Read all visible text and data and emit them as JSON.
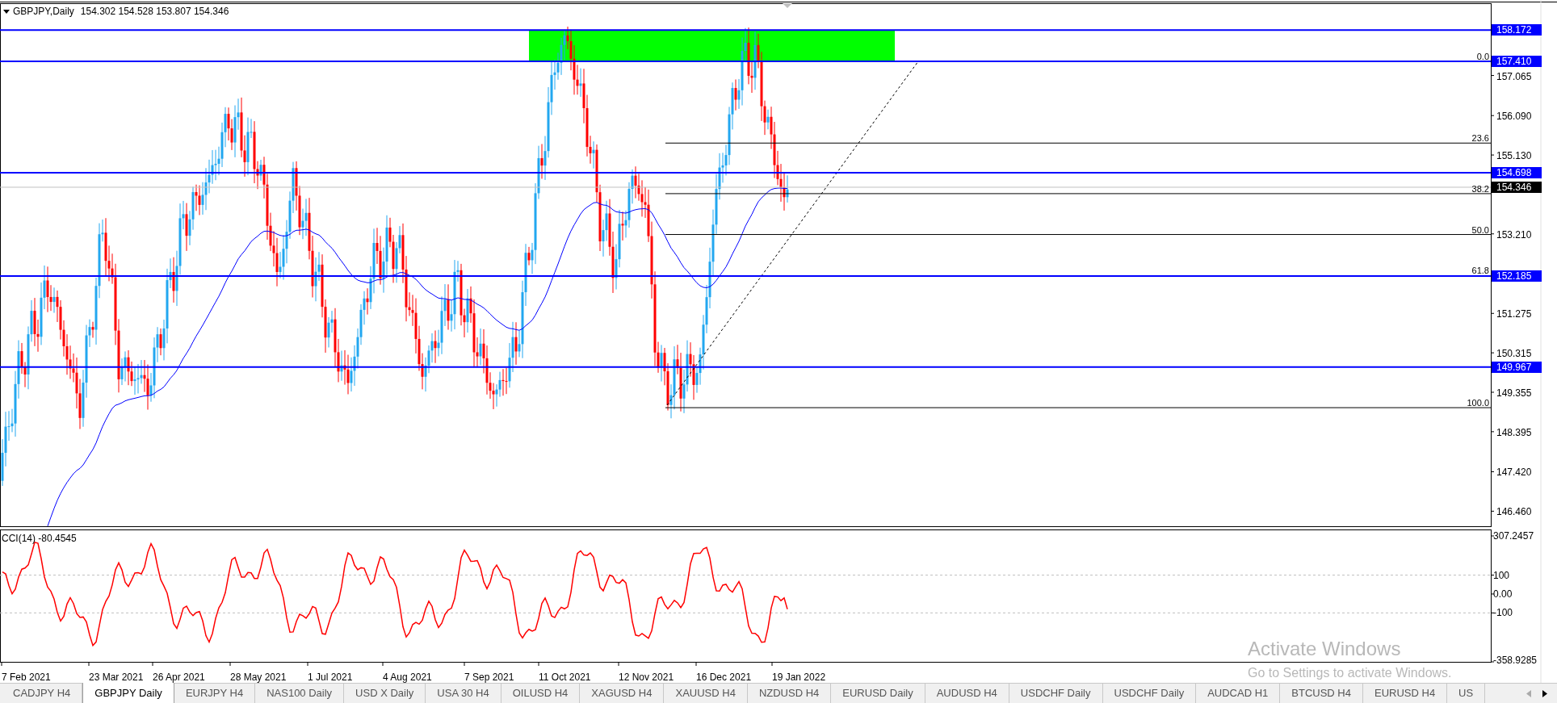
{
  "chart": {
    "symbol": "GBPJPY,Daily",
    "ohlc": "154.302 154.528 153.807 154.346",
    "price_ticks": [
      "157.065",
      "156.090",
      "155.130",
      "153.210",
      "151.275",
      "150.315",
      "149.355",
      "148.395",
      "147.420",
      "146.460"
    ],
    "level_lines": [
      "158.172",
      "157.410",
      "154.698",
      "152.185",
      "149.967"
    ],
    "current_price": "154.346",
    "fibonacci_levels": [
      "0.0",
      "23.6",
      "38.2",
      "50.0",
      "61.8",
      "100.0"
    ]
  },
  "indicator": {
    "title": "CCI(14) -80.4545",
    "ticks": [
      "307.2457",
      "100",
      "0.00",
      "-100",
      "-358.9285"
    ]
  },
  "dates": [
    "7 Feb 2021",
    "23 Mar 2021",
    "26 Apr 2021",
    "28 May 2021",
    "1 Jul 2021",
    "4 Aug 2021",
    "7 Sep 2021",
    "11 Oct 2021",
    "12 Nov 2021",
    "16 Dec 2021",
    "19 Jan 2022"
  ],
  "tabs": [
    {
      "label": "CADJPY H4",
      "selected": false
    },
    {
      "label": "GBPJPY Daily",
      "selected": true
    },
    {
      "label": "EURJPY H4",
      "selected": false
    },
    {
      "label": "NAS100 Daily",
      "selected": false
    },
    {
      "label": "USD X Daily",
      "selected": false
    },
    {
      "label": "USA 30 H4",
      "selected": false
    },
    {
      "label": "OILUSD H4",
      "selected": false
    },
    {
      "label": "XAGUSD H4",
      "selected": false
    },
    {
      "label": "XAUUSD H4",
      "selected": false
    },
    {
      "label": "NZDUSD H4",
      "selected": false
    },
    {
      "label": "EURUSD Daily",
      "selected": false
    },
    {
      "label": "AUDUSD H4",
      "selected": false
    },
    {
      "label": "USDCHF Daily",
      "selected": false
    },
    {
      "label": "USDCHF Daily",
      "selected": false
    },
    {
      "label": "AUDCAD H1",
      "selected": false
    },
    {
      "label": "BTCUSD H4",
      "selected": false
    },
    {
      "label": "EURUSD H4",
      "selected": false
    },
    {
      "label": "US",
      "selected": false
    }
  ],
  "activation_notice": {
    "title": "Activate Windows",
    "subtitle": "Go to Settings to activate Windows."
  }
}
